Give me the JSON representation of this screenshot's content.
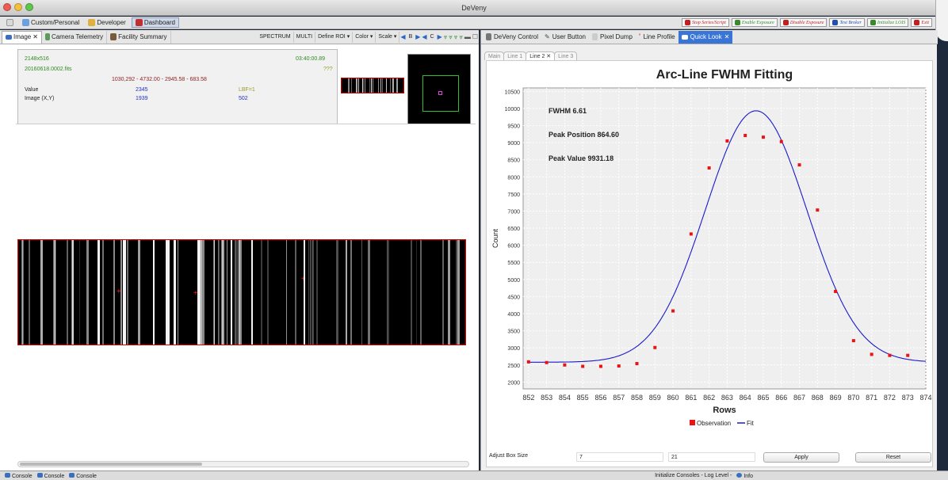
{
  "window": {
    "title": "DeVeny"
  },
  "perspectives": [
    {
      "label": "Custom/Personal"
    },
    {
      "label": "Developer"
    },
    {
      "label": "Dashboard"
    }
  ],
  "actions": [
    {
      "label": "Stop Series/Script",
      "color": "#c02020"
    },
    {
      "label": "Enable Exposure",
      "color": "#3a8a2a"
    },
    {
      "label": "Disable Exposure",
      "color": "#c02020"
    },
    {
      "label": "Test Broker",
      "color": "#2050b0"
    },
    {
      "label": "Initialize LOIS",
      "color": "#3a8a2a"
    },
    {
      "label": "Exit",
      "color": "#c02020"
    }
  ],
  "left_panel": {
    "tabs": [
      {
        "label": "Image"
      },
      {
        "label": "Camera Telemetry"
      },
      {
        "label": "Facility Summary"
      }
    ],
    "toolbar": {
      "spectrum": "SPECTRUM",
      "multi": "MULTI",
      "define_roi": "Define ROI",
      "color": "Color",
      "scale": "Scale",
      "b": "B",
      "c": "C"
    },
    "info": {
      "dims": "2148x516",
      "file": "20160618.0002.fits",
      "time": "03:40:00.89",
      "qqq": "???",
      "coords": "1030,292 - 4732.00 - 2945.58 - 683.58",
      "value_label": "Value",
      "value": "2345",
      "lbf": "LBF=1",
      "imagexy_label": "Image (X,Y)",
      "x": "1939",
      "y": "502"
    }
  },
  "right_panel": {
    "tabs": [
      {
        "label": "DeVeny Control"
      },
      {
        "label": "User Button"
      },
      {
        "label": "Pixel Dump"
      },
      {
        "label": "Line Profile"
      },
      {
        "label": "Quick Look"
      }
    ],
    "subtabs": [
      {
        "label": "Main"
      },
      {
        "label": "Line 1"
      },
      {
        "label": "Line 2"
      },
      {
        "label": "Line 3"
      }
    ],
    "controls": {
      "box_label": "Adjust Box Size",
      "box1": "7",
      "box2": "21",
      "apply": "Apply",
      "reset": "Reset"
    }
  },
  "bottom": {
    "items": [
      {
        "label": "Console"
      },
      {
        "label": "Console"
      },
      {
        "label": "Console"
      }
    ],
    "status": "Initialize Consoles - Log Level -",
    "info": "Info"
  },
  "chart_data": {
    "type": "scatter",
    "title": "Arc-Line FWHM Fitting",
    "xlabel": "Rows",
    "ylabel": "Count",
    "xlim": [
      851.7,
      874
    ],
    "ylim": [
      1800,
      10600
    ],
    "xticks": [
      852,
      853,
      854,
      855,
      856,
      857,
      858,
      859,
      860,
      861,
      862,
      863,
      864,
      865,
      866,
      867,
      868,
      869,
      870,
      871,
      872,
      873,
      874
    ],
    "yticks": [
      2000,
      2500,
      3000,
      3500,
      4000,
      4500,
      5000,
      5500,
      6000,
      6500,
      7000,
      7500,
      8000,
      8500,
      9000,
      9500,
      10000,
      10500
    ],
    "grid": true,
    "legend": "bottom",
    "annotations": [
      "FWHM 6.61",
      "Peak Position 864.60",
      "Peak Value 9931.18"
    ],
    "series": [
      {
        "name": "Observation",
        "color": "#ee1111",
        "x": [
          852,
          853,
          854,
          855,
          856,
          857,
          858,
          859,
          860,
          861,
          862,
          863,
          864,
          865,
          866,
          867,
          868,
          869,
          870,
          871,
          872,
          873
        ],
        "y": [
          2590,
          2570,
          2500,
          2460,
          2460,
          2470,
          2540,
          3010,
          4080,
          6330,
          8260,
          9050,
          9210,
          9160,
          9030,
          8350,
          7030,
          4650,
          3210,
          2810,
          2780,
          2780
        ]
      },
      {
        "name": "Fit",
        "color": "#1a1acc",
        "fit": {
          "baseline": 2580,
          "peak": 9931.18,
          "center": 864.6,
          "fwhm": 6.61
        }
      }
    ]
  }
}
